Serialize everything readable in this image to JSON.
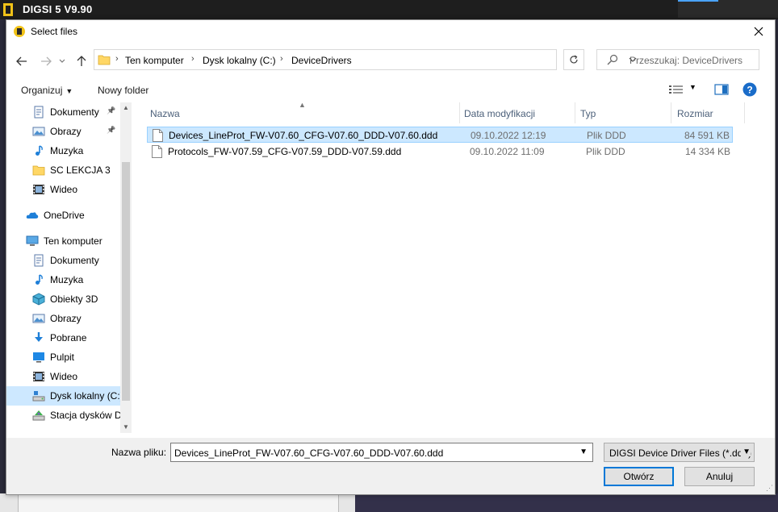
{
  "app": {
    "title": "DIGSI 5 V9.90"
  },
  "dialog": {
    "title": "Select files",
    "close_label": "✕"
  },
  "address": {
    "breadcrumbs": [
      "Ten komputer",
      "Dysk lokalny (C:)",
      "DeviceDrivers"
    ],
    "separator": "›"
  },
  "search": {
    "placeholder": "Przeszukaj: DeviceDrivers"
  },
  "toolbar": {
    "organize_label": "Organizuj",
    "new_folder_label": "Nowy folder"
  },
  "sidebar": {
    "items": [
      {
        "label": "Dokumenty",
        "icon": "documents-icon",
        "pinned": true
      },
      {
        "label": "Obrazy",
        "icon": "pictures-icon",
        "pinned": true
      },
      {
        "label": "Muzyka",
        "icon": "music-icon"
      },
      {
        "label": "SC LEKCJA 3",
        "icon": "folder-icon"
      },
      {
        "label": "Wideo",
        "icon": "video-icon"
      },
      {
        "label": "OneDrive",
        "icon": "onedrive-icon"
      },
      {
        "label": "Ten komputer",
        "icon": "computer-icon"
      },
      {
        "label": "Dokumenty",
        "icon": "documents-icon"
      },
      {
        "label": "Muzyka",
        "icon": "music-icon"
      },
      {
        "label": "Obiekty 3D",
        "icon": "objects-3d-icon"
      },
      {
        "label": "Obrazy",
        "icon": "pictures-icon"
      },
      {
        "label": "Pobrane",
        "icon": "downloads-icon"
      },
      {
        "label": "Pulpit",
        "icon": "desktop-icon"
      },
      {
        "label": "Wideo",
        "icon": "video-icon"
      },
      {
        "label": "Dysk lokalny (C:)",
        "icon": "local-disk-icon",
        "selected": true
      },
      {
        "label": "Stacja dysków DVD",
        "icon": "dvd-drive-icon"
      }
    ]
  },
  "columns": {
    "name": "Nazwa",
    "modified": "Data modyfikacji",
    "type": "Typ",
    "size": "Rozmiar"
  },
  "files": [
    {
      "name": "Devices_LineProt_FW-V07.60_CFG-V07.60_DDD-V07.60.ddd",
      "modified": "09.10.2022 12:19",
      "type": "Plik DDD",
      "size": "84 591 KB",
      "selected": true
    },
    {
      "name": "Protocols_FW-V07.59_CFG-V07.59_DDD-V07.59.ddd",
      "modified": "09.10.2022 11:09",
      "type": "Plik DDD",
      "size": "14 334 KB"
    }
  ],
  "footer": {
    "filename_label": "Nazwa pliku:",
    "filename_value": "Devices_LineProt_FW-V07.60_CFG-V07.60_DDD-V07.60.ddd",
    "filetype_value": "DIGSI Device Driver Files (*.ddd)",
    "open_label": "Otwórz",
    "cancel_label": "Anuluj"
  },
  "colors": {
    "selection": "#cce8ff",
    "accent": "#0078d7",
    "header_text": "#4c607a"
  }
}
